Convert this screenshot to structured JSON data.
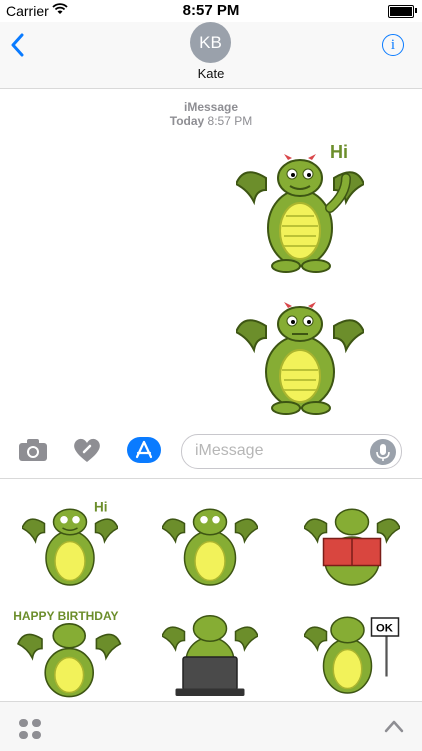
{
  "status_bar": {
    "carrier": "Carrier",
    "time": "8:57 PM"
  },
  "nav": {
    "avatar_initials": "KB",
    "contact_name": "Kate",
    "back_icon": "chevron-left-icon",
    "info_icon": "info-icon"
  },
  "thread": {
    "service": "iMessage",
    "day": "Today",
    "time": "8:57 PM",
    "stickers": [
      {
        "name": "dragon-waving-hi-sticker",
        "caption": "Hi"
      },
      {
        "name": "dragon-hands-on-hips-sticker",
        "caption": ""
      }
    ]
  },
  "compose": {
    "placeholder": "iMessage",
    "icons": [
      "camera-icon",
      "digital-touch-heart-icon",
      "app-store-icon",
      "microphone-icon"
    ],
    "accent": "#0a7bff"
  },
  "sticker_drawer": {
    "items": [
      {
        "name": "sticker-dragon-hi",
        "caption": "Hi"
      },
      {
        "name": "sticker-dragon-hips",
        "caption": ""
      },
      {
        "name": "sticker-dragon-reading",
        "caption": ""
      },
      {
        "name": "sticker-dragon-happy-birthday",
        "caption": "HAPPY BIRTHDAY"
      },
      {
        "name": "sticker-dragon-laptop",
        "caption": ""
      },
      {
        "name": "sticker-dragon-ok-sign",
        "caption": "OK"
      }
    ]
  },
  "bottom_bar": {
    "apps_icon": "app-drawer-grid-icon",
    "expand_icon": "chevron-up-icon"
  }
}
